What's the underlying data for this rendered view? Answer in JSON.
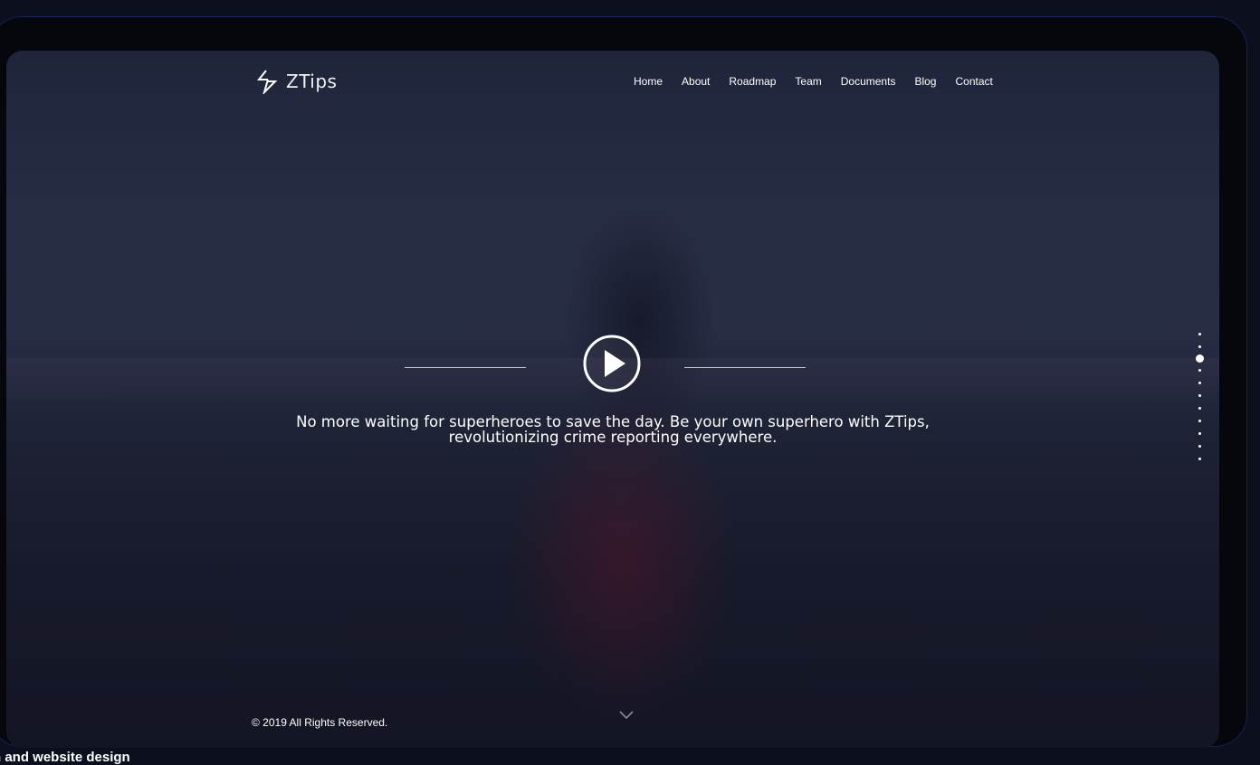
{
  "brand": {
    "name": "ZTips",
    "logo_icon": "ztips-bolt-logo-icon"
  },
  "nav": {
    "items": [
      {
        "label": "Home"
      },
      {
        "label": "About"
      },
      {
        "label": "Roadmap"
      },
      {
        "label": "Team"
      },
      {
        "label": "Documents"
      },
      {
        "label": "Blog"
      },
      {
        "label": "Contact"
      }
    ]
  },
  "hero": {
    "play_icon": "play-circle-icon",
    "tagline_line1": "No more waiting for superheroes to save the day. Be your own superhero with ZTips,",
    "tagline_line2": "revolutionizing crime reporting everywhere."
  },
  "pager": {
    "count": 11,
    "active_index": 2
  },
  "scroll_hint": {
    "icon": "chevron-down-icon"
  },
  "footer": {
    "copyright": "© 2019 All Rights Reserved."
  },
  "caption": {
    "text": "n and website design"
  },
  "colors": {
    "text": "#ffffff",
    "background": "#0b0f1e",
    "frame_border": "#16205a"
  }
}
